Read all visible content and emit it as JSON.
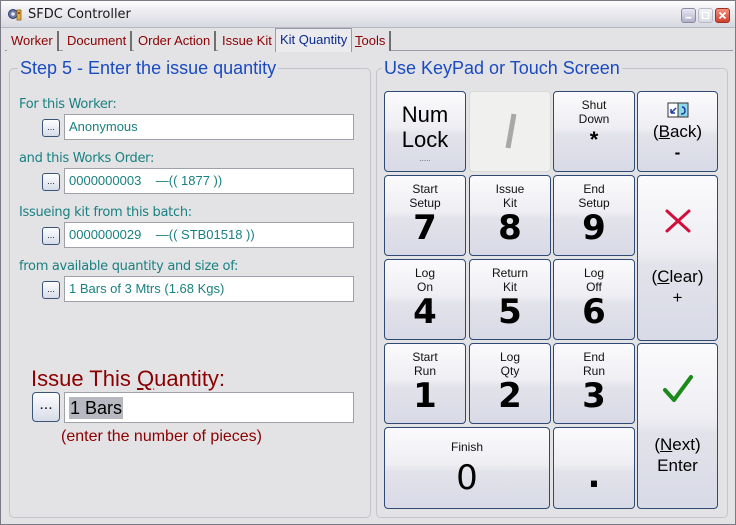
{
  "window": {
    "title": "SFDC Controller",
    "app_icon": "gear-app-icon",
    "controls": [
      "minimize",
      "maximize",
      "close"
    ]
  },
  "tabs": [
    {
      "label": "Worker",
      "active": false
    },
    {
      "label": "Document",
      "active": false
    },
    {
      "label": "Order Action",
      "active": false
    },
    {
      "label": "Issue Kit",
      "active": false
    },
    {
      "label": "Kit Quantity",
      "active": true
    },
    {
      "label_prefix": "",
      "label_accel": "T",
      "label_rest": "ools",
      "label": "Tools",
      "active": false
    }
  ],
  "left_panel": {
    "title": "Step 5 - Enter the issue quantity",
    "fields": [
      {
        "label": "For this Worker:",
        "value": "Anonymous",
        "button": "..."
      },
      {
        "label": "and this Works Order:",
        "value": "0000000003    —(( 1877 ))",
        "button": "..."
      },
      {
        "label": "Issueing kit from this batch:",
        "value": "0000000029    —(( STB01518 ))",
        "button": "..."
      },
      {
        "label": "from available quantity and size of:",
        "value": "1 Bars of 3 Mtrs (1.68 Kgs)",
        "button": "..."
      }
    ],
    "quantity": {
      "label_prefix": "Issue This ",
      "label_accel": "Q",
      "label_rest": "uantity:",
      "button": "...",
      "value": "1 Bars",
      "hint": "(enter the number of pieces)"
    }
  },
  "right_panel": {
    "title": "Use KeyPad or Touch Screen",
    "keys": {
      "numlock": {
        "line1": "Num",
        "line2": "Lock",
        "sub": "....."
      },
      "slash": {
        "glyph": "/"
      },
      "shutdown": {
        "line1": "Shut",
        "line2": "Down",
        "key": "*"
      },
      "back": {
        "icon": "back-arrow-icon",
        "open": "(",
        "accel": "B",
        "rest": "ack)",
        "key": "-"
      },
      "k7": {
        "line1": "Start",
        "line2": "Setup",
        "digit": "7"
      },
      "k8": {
        "line1": "Issue",
        "line2": "Kit",
        "digit": "8"
      },
      "k9": {
        "line1": "End",
        "line2": "Setup",
        "digit": "9"
      },
      "clear": {
        "icon": "red-x-icon",
        "open": "(",
        "accel": "C",
        "rest": "lear)",
        "key": "+"
      },
      "k4": {
        "line1": "Log",
        "line2": "On",
        "digit": "4"
      },
      "k5": {
        "line1": "Return",
        "line2": "Kit",
        "digit": "5"
      },
      "k6": {
        "line1": "Log",
        "line2": "Off",
        "digit": "6"
      },
      "k1": {
        "line1": "Start",
        "line2": "Run",
        "digit": "1"
      },
      "k2": {
        "line1": "Log",
        "line2": "Qty",
        "digit": "2"
      },
      "k3": {
        "line1": "End",
        "line2": "Run",
        "digit": "3"
      },
      "next": {
        "icon": "green-check-icon",
        "open": "(",
        "accel": "N",
        "rest": "ext)",
        "key": "Enter"
      },
      "k0": {
        "line1": "Finish",
        "digit": "0"
      },
      "dot": {
        "digit": "."
      }
    }
  },
  "colors": {
    "panel_title": "#1a4bbf",
    "field_label": "#1a8080",
    "tab_inactive": "#8b0000",
    "tab_active": "#0a2a8c",
    "quantity_text": "#8b0000",
    "clear_icon": "#d0103a",
    "check_icon": "#1a8a1a"
  }
}
